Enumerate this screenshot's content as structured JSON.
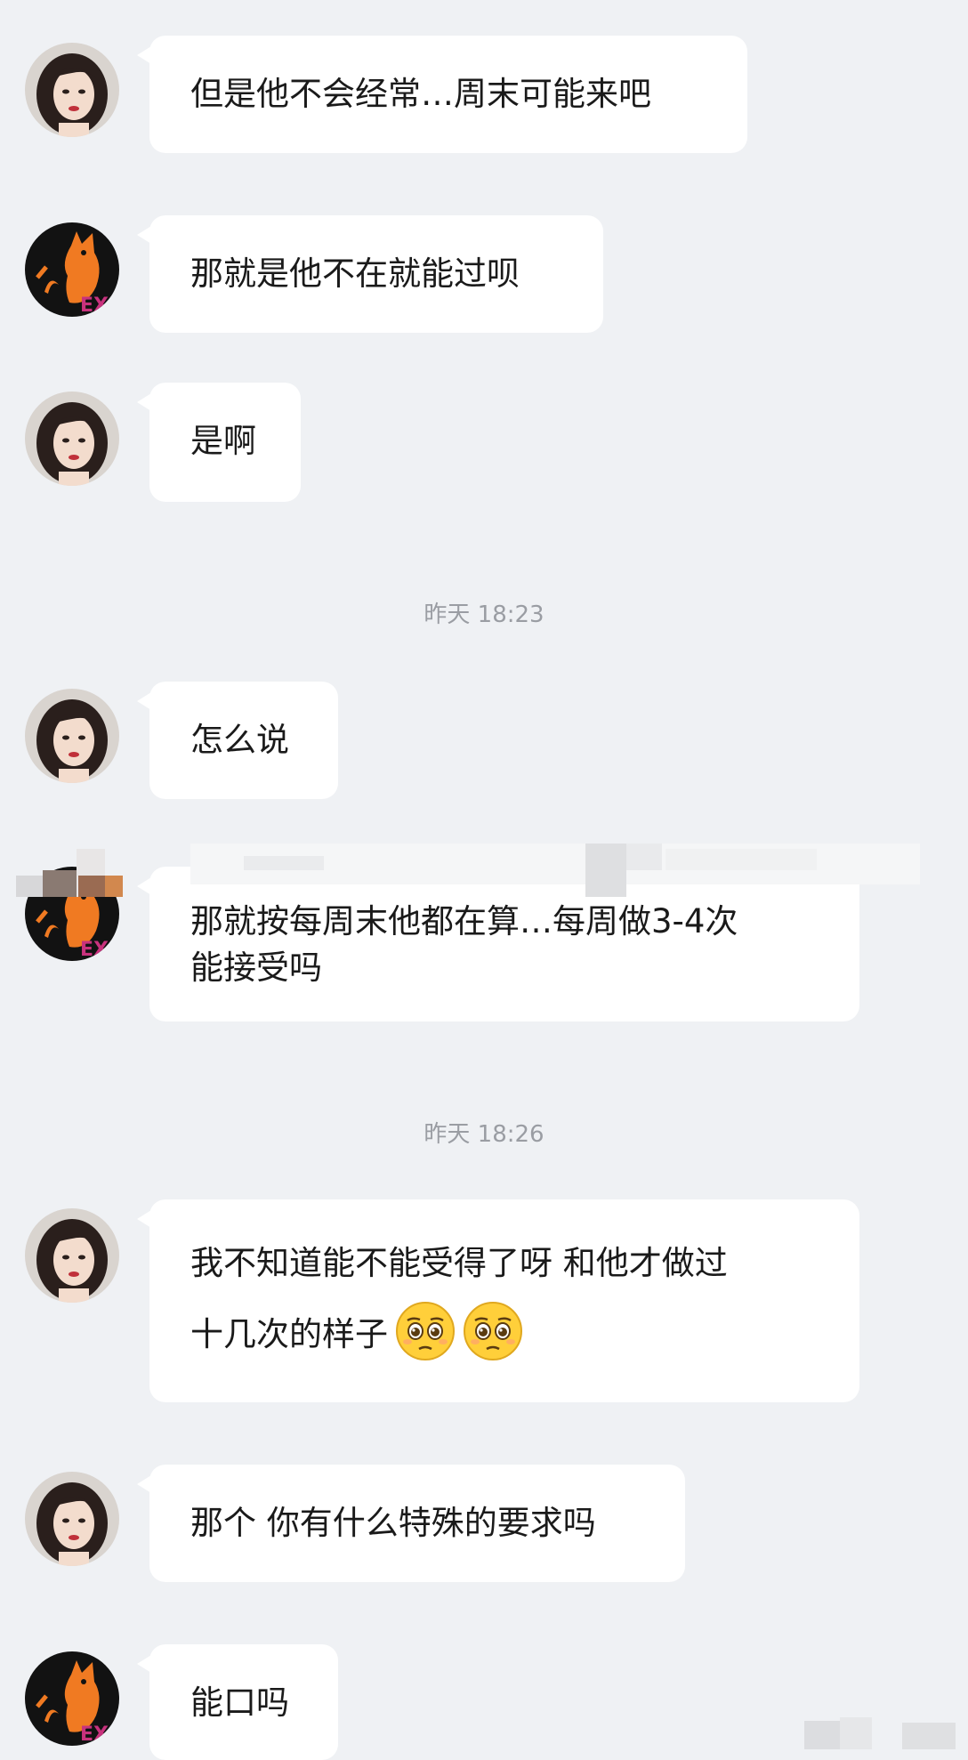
{
  "timestamps": {
    "t1": "昨天 18:23",
    "t2": "昨天 18:26"
  },
  "messages": [
    {
      "sender": "woman",
      "text": "但是他不会经常…周末可能来吧"
    },
    {
      "sender": "cat",
      "text": "那就是他不在就能过呗"
    },
    {
      "sender": "woman",
      "text": "是啊"
    },
    {
      "sender": "woman",
      "text": "怎么说"
    },
    {
      "sender": "cat",
      "line1": "那就按每周末他都在算…每周做3-4次",
      "line2": "能接受吗"
    },
    {
      "sender": "woman",
      "line1": "我不知道能不能受得了呀 和他才做过",
      "line2": "十几次的样子",
      "emoji": "pleading-face-icon"
    },
    {
      "sender": "woman",
      "text": "那个 你有什么特殊的要求吗"
    },
    {
      "sender": "cat",
      "text": "能口吗"
    }
  ],
  "avatar_badge": "EX",
  "colors": {
    "background": "#eff1f4",
    "bubble": "#ffffff",
    "timestamp": "#9a9da3",
    "text": "#1a1a1a"
  }
}
